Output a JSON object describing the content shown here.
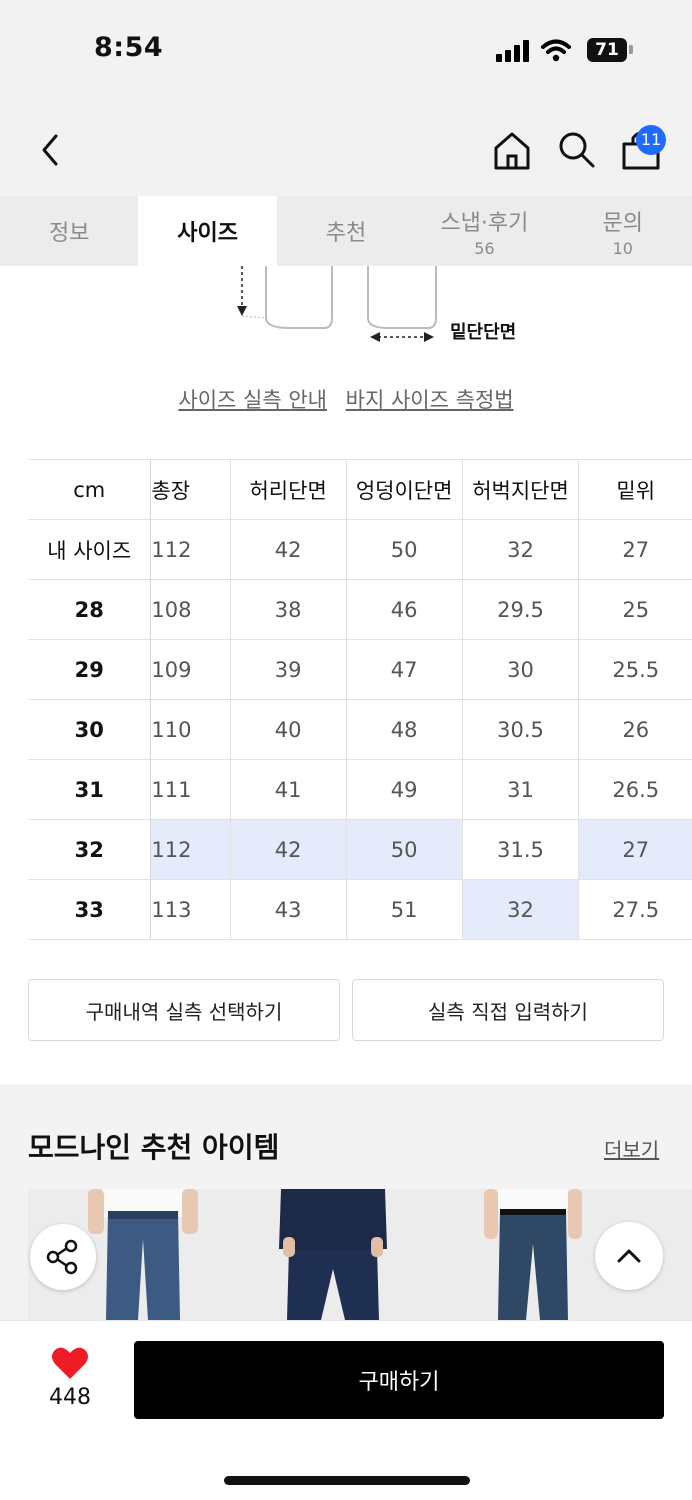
{
  "status_bar": {
    "time": "8:54",
    "battery": "71"
  },
  "header": {
    "cart_count": "11"
  },
  "tabs": [
    {
      "label": "정보",
      "count": ""
    },
    {
      "label": "사이즈",
      "count": ""
    },
    {
      "label": "추천",
      "count": ""
    },
    {
      "label": "스냅·후기",
      "count": "56"
    },
    {
      "label": "문의",
      "count": "10"
    }
  ],
  "diagram": {
    "hem_label": "밑단단면"
  },
  "guide_links": {
    "actual_size": "사이즈 실측 안내",
    "measure_method": "바지 사이즈 측정법"
  },
  "size_table": {
    "columns": [
      "cm",
      "총장",
      "허리단면",
      "엉덩이단면",
      "허벅지단면",
      "밑위"
    ],
    "rows": [
      {
        "label": "내 사이즈",
        "values": [
          "112",
          "42",
          "50",
          "32",
          "27"
        ]
      },
      {
        "label": "28",
        "values": [
          "108",
          "38",
          "46",
          "29.5",
          "25"
        ]
      },
      {
        "label": "29",
        "values": [
          "109",
          "39",
          "47",
          "30",
          "25.5"
        ]
      },
      {
        "label": "30",
        "values": [
          "110",
          "40",
          "48",
          "30.5",
          "26"
        ]
      },
      {
        "label": "31",
        "values": [
          "111",
          "41",
          "49",
          "31",
          "26.5"
        ]
      },
      {
        "label": "32",
        "values": [
          "112",
          "42",
          "50",
          "31.5",
          "27"
        ]
      },
      {
        "label": "33",
        "values": [
          "113",
          "43",
          "51",
          "32",
          "27.5"
        ]
      }
    ],
    "highlight_color": "#e6ebfc"
  },
  "actions": {
    "select_history": "구매내역 실측 선택하기",
    "direct_input": "실측 직접 입력하기"
  },
  "recommend": {
    "title": "모드나인 추천 아이템",
    "more": "더보기"
  },
  "bottom_bar": {
    "like_count": "448",
    "buy_label": "구매하기"
  },
  "colors": {
    "accent_badge": "#1f6bff",
    "like": "#ee1c25",
    "buy_button": "#000000"
  }
}
